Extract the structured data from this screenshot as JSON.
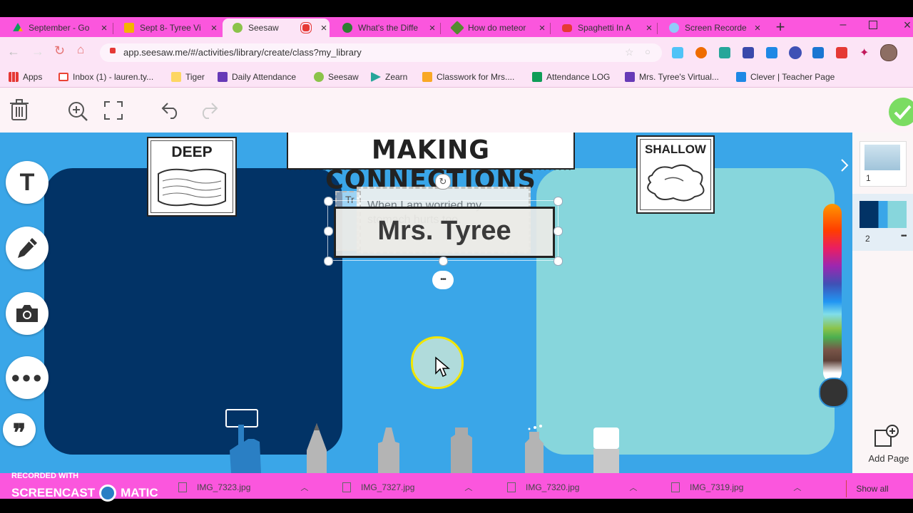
{
  "tabs": [
    {
      "label": "September - Go",
      "color": "#1a73e8"
    },
    {
      "label": "Sept 8- Tyree Vi",
      "color": "#f4b400"
    },
    {
      "label": "Seesaw",
      "color": "#8bc34a"
    },
    {
      "label": "What's the Diffe",
      "color": "#2e7d32"
    },
    {
      "label": "How do meteor",
      "color": "#558b2f"
    },
    {
      "label": "Spaghetti In A",
      "color": "#e53935"
    },
    {
      "label": "Screen Recorde",
      "color": "#90caf9"
    }
  ],
  "address": {
    "url": "app.seesaw.me/#/activities/library/create/class?my_library"
  },
  "bookmarks": [
    {
      "label": "Apps",
      "color": "#e53935"
    },
    {
      "label": "Inbox (1) - lauren.ty...",
      "color": "#ea4335"
    },
    {
      "label": "Tiger",
      "color": "#fdd663"
    },
    {
      "label": "Daily Attendance",
      "color": "#673ab7"
    },
    {
      "label": "Seesaw",
      "color": "#8bc34a"
    },
    {
      "label": "Zearn",
      "color": "#26a69a"
    },
    {
      "label": "Classwork for Mrs....",
      "color": "#f9a825"
    },
    {
      "label": "Attendance LOG",
      "color": "#0f9d58"
    },
    {
      "label": "Mrs. Tyree's Virtual...",
      "color": "#673ab7"
    },
    {
      "label": "Clever | Teacher Page",
      "color": "#1e88e5"
    }
  ],
  "canvas": {
    "title": "MAKING CONNECTIONS",
    "deep_label": "DEEP",
    "shallow_label": "SHALLOW",
    "card_text_back": "When I am worried my stomach hurts too.",
    "card_text_front": "Mrs. Tyree",
    "card_peek": "Tr",
    "more_dots": "•••"
  },
  "right_panel": {
    "pages": [
      "1",
      "2"
    ],
    "add_page_label": "Add Page"
  },
  "taskbar": {
    "recorded_with": "RECORDED WITH",
    "brand_left": "SCREENCAST",
    "brand_right": "MATIC",
    "downloads": [
      "IMG_7323.jpg",
      "IMG_7327.jpg",
      "IMG_7320.jpg",
      "IMG_7319.jpg"
    ],
    "show_all": "Show all"
  },
  "colors": {
    "tab_strip": "#fb56dd",
    "canvas": "#3aa6e8",
    "deep_panel": "#023366",
    "shallow_panel": "#87d6dc"
  }
}
